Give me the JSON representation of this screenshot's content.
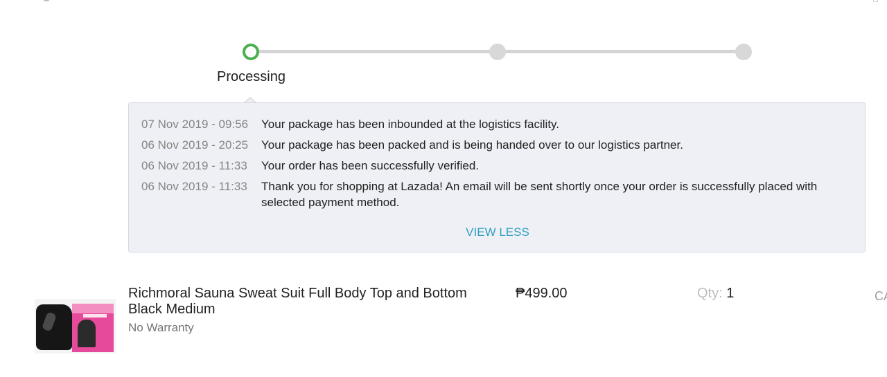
{
  "stepper": {
    "steps": [
      {
        "label": "Processing",
        "state": "active"
      },
      {
        "label": "",
        "state": "pending"
      },
      {
        "label": "",
        "state": "pending"
      }
    ],
    "active_color": "#4caf50",
    "inactive_color": "#d8d8d8"
  },
  "history": {
    "entries": [
      {
        "time": "07 Nov 2019 - 09:56",
        "message": "Your package has been inbounded at the logistics facility."
      },
      {
        "time": "06 Nov 2019 - 20:25",
        "message": "Your package has been packed and is being handed over to our logistics partner."
      },
      {
        "time": "06 Nov 2019 - 11:33",
        "message": "Your order has been successfully verified."
      },
      {
        "time": "06 Nov 2019 - 11:33",
        "message": "Thank you for shopping at Lazada! An email will be sent shortly once your order is successfully placed with selected payment method."
      }
    ],
    "toggle_label": "VIEW LESS",
    "link_color": "#2d9fc1"
  },
  "product": {
    "title": "Richmoral Sauna Sweat Suit Full Body Top and Bottom Black Medium",
    "warranty": "No Warranty",
    "price": "₱499.00",
    "qty_label": "Qty:",
    "qty_value": "1",
    "status_cut": "CA"
  }
}
